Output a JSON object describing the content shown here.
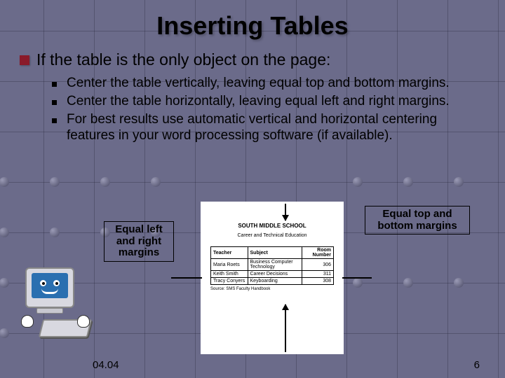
{
  "title": "Inserting Tables",
  "main_bullet": "If the table is the only object on the page:",
  "sub_bullets": [
    "Center the table vertically, leaving equal top and bottom margins.",
    "Center the table horizontally, leaving equal left and right margins.",
    "For best results use automatic vertical and horizontal centering features in your word processing software (if available)."
  ],
  "callouts": {
    "left": "Equal left and right margins",
    "right": "Equal top and bottom margins"
  },
  "paper": {
    "title": "SOUTH MIDDLE SCHOOL",
    "subtitle": "Career and Technical Education",
    "headers": [
      "Teacher",
      "Subject",
      "Room Number"
    ],
    "rows": [
      [
        "Maria Roets",
        "Business Computer Technology",
        "306"
      ],
      [
        "Keith Smith",
        "Career Decisions",
        "311"
      ],
      [
        "Tracy Conyers",
        "Keyboarding",
        "308"
      ]
    ],
    "source": "Source: SMS Faculty Handbook"
  },
  "footer": {
    "code": "04.04",
    "page": "6"
  }
}
